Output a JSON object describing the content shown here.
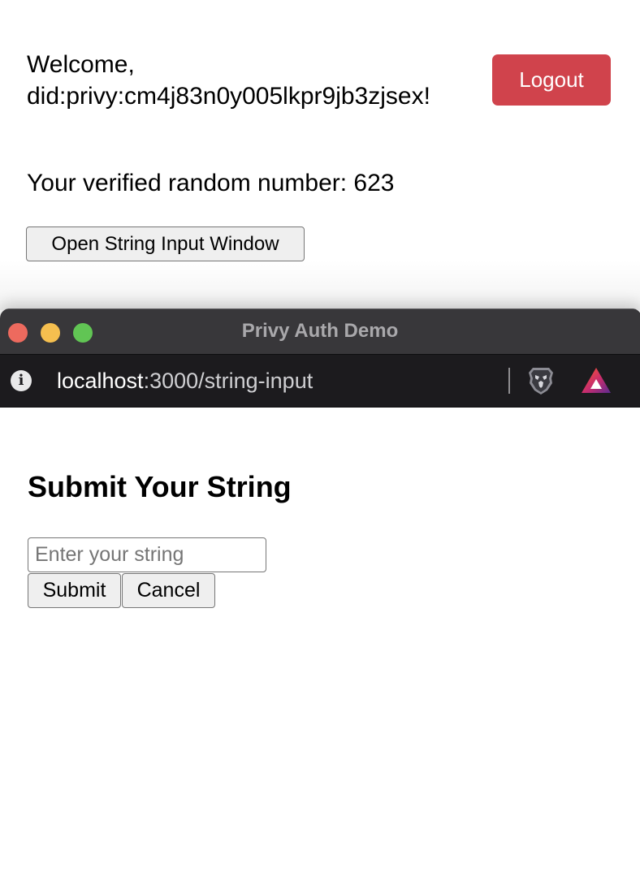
{
  "main_page": {
    "welcome_line1": "Welcome,",
    "welcome_line2": "did:privy:cm4j83n0y005lkpr9jb3zjsex!",
    "logout_label": "Logout",
    "random_number_text": "Your verified random number: 623",
    "open_window_label": "Open String Input Window"
  },
  "popup": {
    "window_title": "Privy Auth Demo",
    "url_host": "localhost",
    "url_rest": ":3000/string-input",
    "info_icon": "info-icon",
    "brave_shield_icon": "brave-lion-icon",
    "rewards_icon": "brave-rewards-triangle-icon",
    "heading": "Submit Your String",
    "input_placeholder": "Enter your string",
    "input_value": "",
    "submit_label": "Submit",
    "cancel_label": "Cancel"
  },
  "colors": {
    "logout_bg": "#d0434c",
    "titlebar_bg": "#38373a",
    "addressbar_bg": "#1c1b1e",
    "traffic_close": "#ed6a5e",
    "traffic_min": "#f5bf4f",
    "traffic_max": "#61c554"
  }
}
